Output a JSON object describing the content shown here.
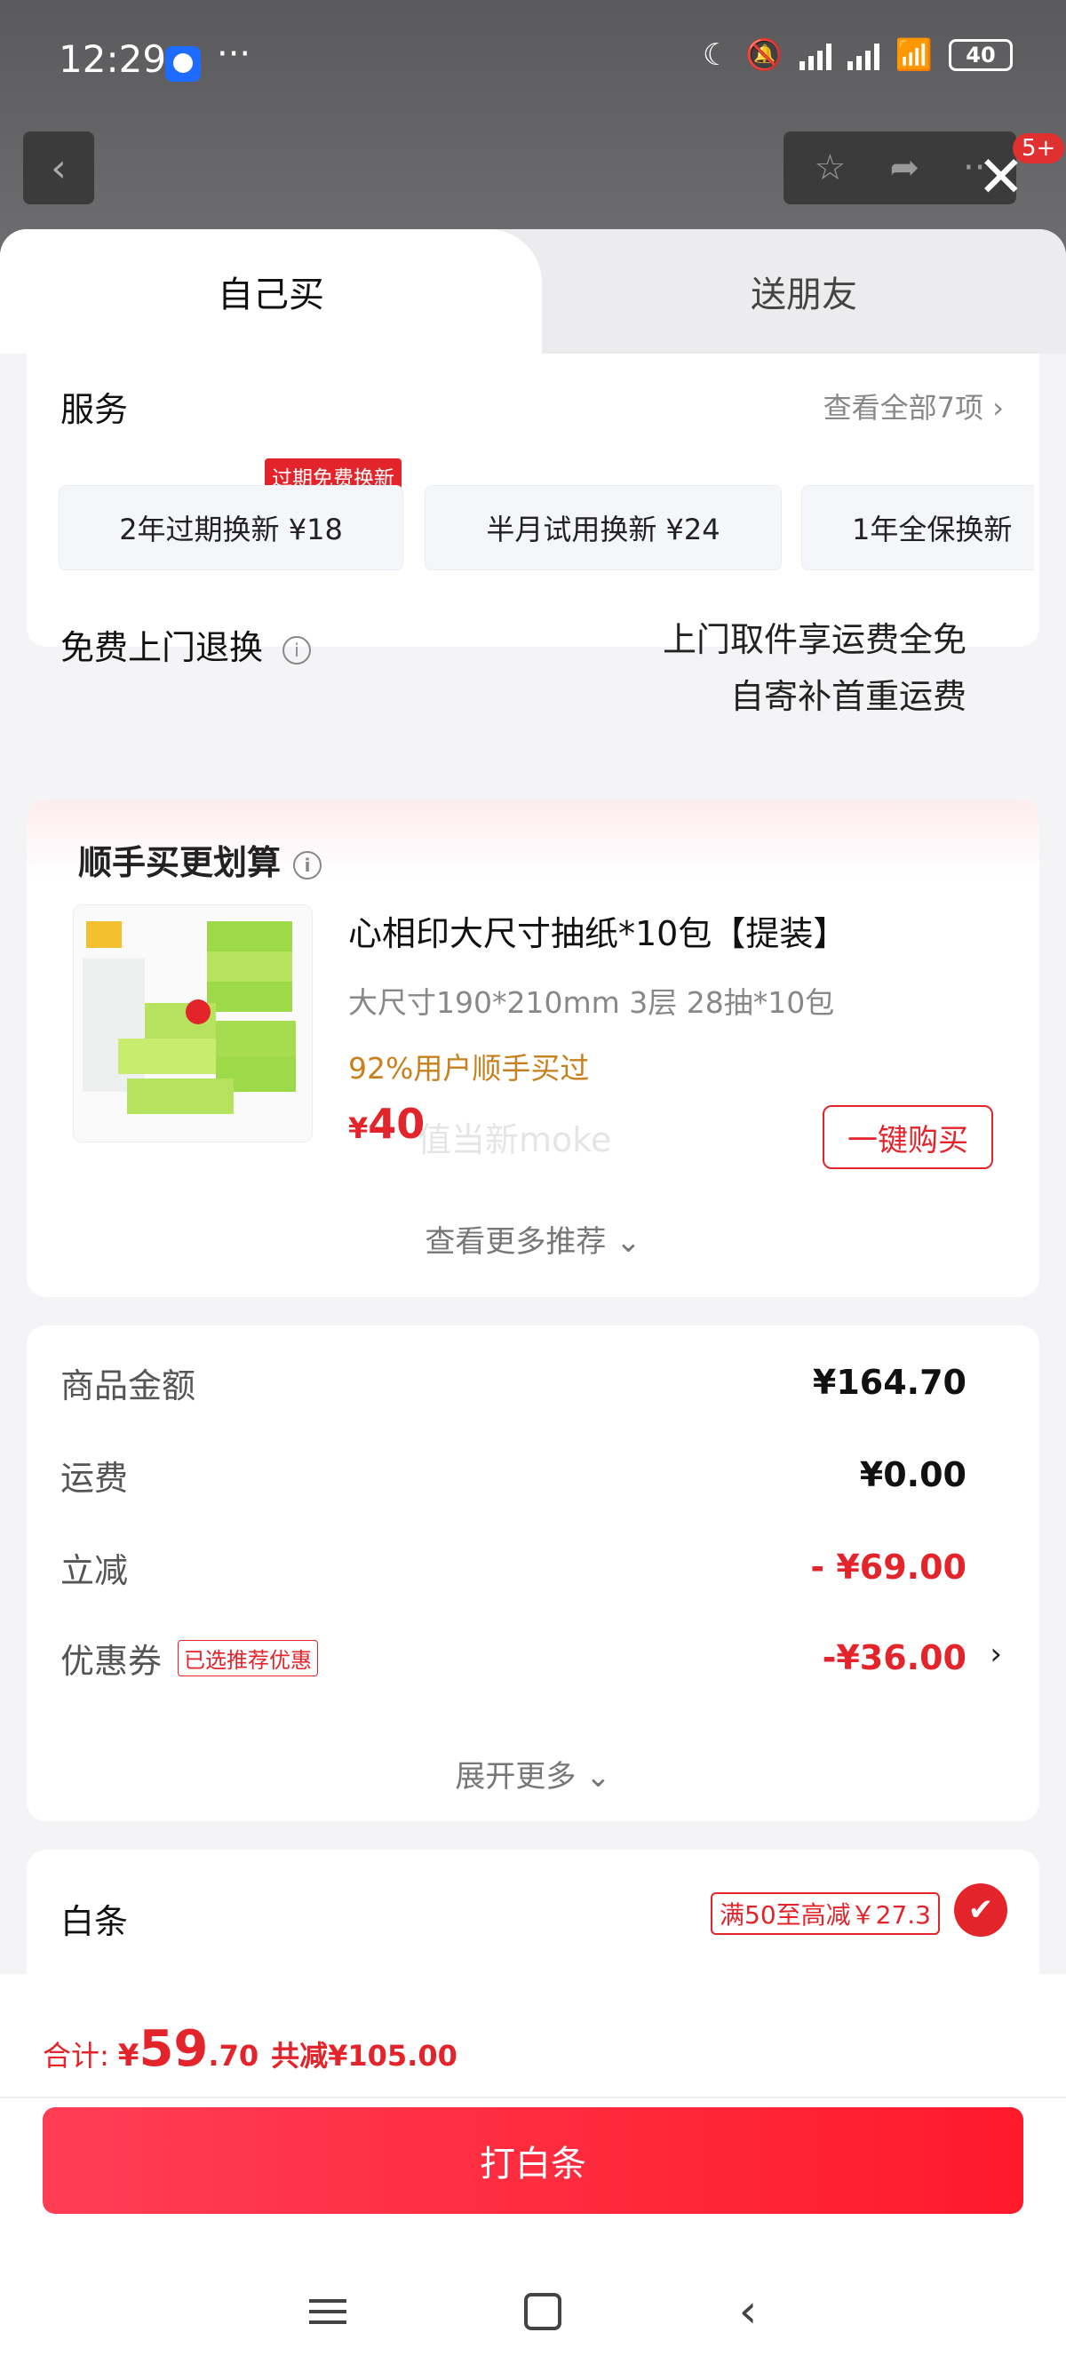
{
  "status_bar": {
    "time": "12:29",
    "dots": "···",
    "battery": "40"
  },
  "nav": {
    "badge": "5+"
  },
  "tabs": [
    {
      "label": "自己买"
    },
    {
      "label": "送朋友"
    }
  ],
  "service": {
    "title": "服务",
    "view_all": "查看全部7项",
    "chips": [
      {
        "label": "2年过期换新  ¥18",
        "tag": "过期免费换新"
      },
      {
        "label": "半月试用换新  ¥24"
      },
      {
        "label": "1年全保换新"
      }
    ],
    "free_return_title": "免费上门退换",
    "free_return_line1": "上门取件享运费全免",
    "free_return_line2": "自寄补首重运费"
  },
  "recommend": {
    "title": "顺手买更划算",
    "product_name": "心相印大尺寸抽纸*10包【提装】",
    "product_spec": "大尺寸190*210mm 3层 28抽*10包",
    "bought_text": "92%用户顺手买过",
    "price_currency": "¥",
    "price_value": "40",
    "watermark": "值当新moke",
    "buy_label": "一键购买",
    "more_label": "查看更多推荐"
  },
  "price": {
    "rows": [
      {
        "label": "商品金额",
        "value": "¥164.70"
      },
      {
        "label": "运费",
        "value": "¥0.00"
      },
      {
        "label": "立减",
        "value": "- ¥69.00"
      },
      {
        "label": "优惠券",
        "tag": "已选推荐优惠",
        "value": "-¥36.00"
      }
    ],
    "expand_label": "展开更多"
  },
  "payment": {
    "label": "白条",
    "promo": "满50至高减￥27.3"
  },
  "footer": {
    "total_label": "合计:",
    "currency": "¥",
    "total_int": "59",
    "total_dec": ".70",
    "saved": "共减¥105.00",
    "button_label": "打白条"
  },
  "colors": {
    "accent": "#e3242b",
    "orange": "#c8801e"
  }
}
